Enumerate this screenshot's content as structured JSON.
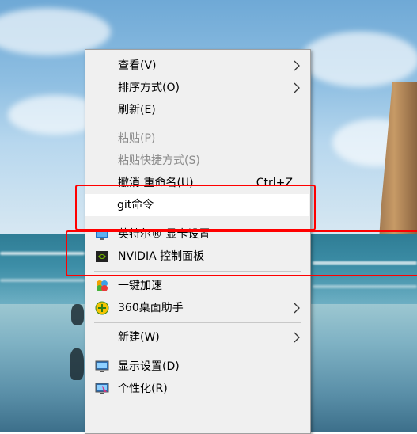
{
  "menu": {
    "items": [
      {
        "label": "查看(V)",
        "submenu": true
      },
      {
        "label": "排序方式(O)",
        "submenu": true
      },
      {
        "label": "刷新(E)"
      },
      {
        "label": "粘贴(P)",
        "disabled": true
      },
      {
        "label": "粘贴快捷方式(S)",
        "disabled": true
      },
      {
        "label": "撤消 重命名(U)",
        "shortcut": "Ctrl+Z"
      },
      {
        "label": "git命令"
      },
      {
        "label": "英特尔® 显卡设置",
        "icon": "intel-graphics-icon"
      },
      {
        "label": "NVIDIA 控制面板",
        "icon": "nvidia-icon"
      },
      {
        "label": "一键加速",
        "icon": "360-speedup-icon"
      },
      {
        "label": "360桌面助手",
        "icon": "360-desktop-icon",
        "submenu": true
      },
      {
        "label": "新建(W)",
        "submenu": true
      },
      {
        "label": "显示设置(D)",
        "icon": "display-settings-icon"
      },
      {
        "label": "个性化(R)",
        "icon": "personalize-icon"
      }
    ]
  },
  "colors": {
    "menu_bg": "#f0f0f0",
    "highlight_bg": "#ffffff",
    "disabled_text": "#8c8c8c",
    "annotation_red": "#ff0000"
  }
}
